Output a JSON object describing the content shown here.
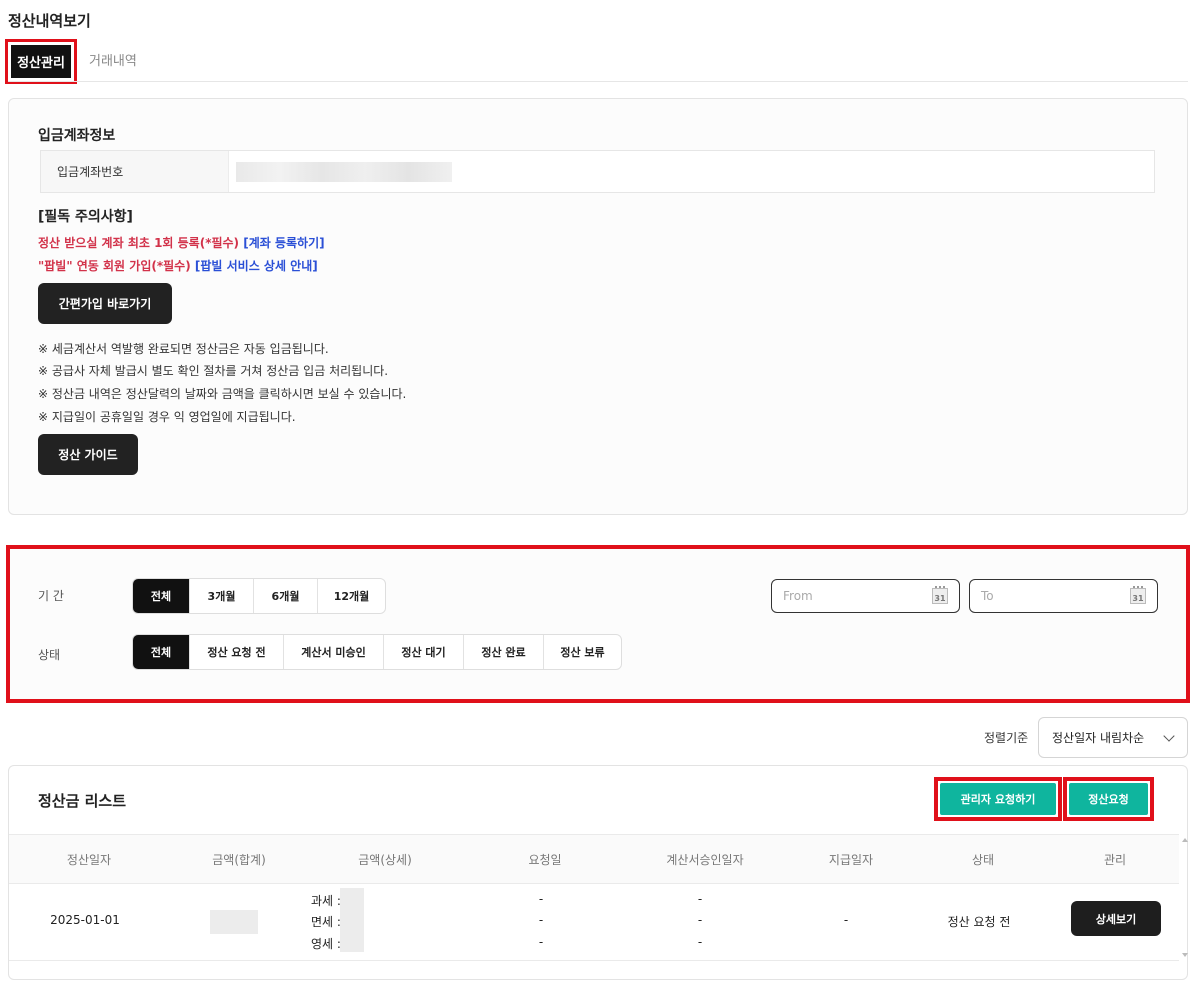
{
  "page_title": "정산내역보기",
  "tabs": [
    {
      "label": "정산관리",
      "active": true
    },
    {
      "label": "거래내역",
      "active": false
    }
  ],
  "account": {
    "section_title": "입금계좌정보",
    "label": "입금계좌번호"
  },
  "notice": {
    "title": "[필독 주의사항]",
    "line1_text": "정산 받으실 계좌 최초 1회 등록(*필수)",
    "line1_link": "[계좌 등록하기]",
    "line2_text": "\"팝빌\" 연동 회원 가입(*필수)",
    "line2_link": "[팝빌 서비스 상세 안내]",
    "signup_button": "간편가입 바로가기",
    "bullets": [
      "※ 세금계산서 역발행 완료되면 정산금은 자동 입금됩니다.",
      "※ 공급사 자체 발급시 별도 확인 절차를 거쳐 정산금 입금 처리됩니다.",
      "※ 정산금 내역은 정산달력의 날짜와 금액을 클릭하시면 보실 수 있습니다.",
      "※ 지급일이 공휴일일 경우 익 영업일에 지급됩니다."
    ],
    "guide_button": "정산 가이드"
  },
  "filters": {
    "period_label": "기 간",
    "period_options": [
      "전체",
      "3개월",
      "6개월",
      "12개월"
    ],
    "status_label": "상태",
    "status_options": [
      "전체",
      "정산 요청 전",
      "계산서 미승인",
      "정산 대기",
      "정산 완료",
      "정산 보류"
    ],
    "from_placeholder": "From",
    "to_placeholder": "To",
    "calendar_day": "31"
  },
  "sort": {
    "label": "정렬기준",
    "selected": "정산일자 내림차순"
  },
  "list": {
    "title": "정산금 리스트",
    "admin_request_button": "관리자 요청하기",
    "settle_request_button": "정산요청",
    "columns": [
      "정산일자",
      "금액(합계)",
      "금액(상세)",
      "요청일",
      "계산서승인일자",
      "지급일자",
      "상태",
      "관리"
    ],
    "rows": [
      {
        "date": "2025-01-01",
        "detail_labels": [
          "과세 :",
          "면세 :",
          "영세 :"
        ],
        "request_dates": [
          "-",
          "-",
          "-"
        ],
        "invoice_dates": [
          "-",
          "-",
          "-"
        ],
        "pay_date": "-",
        "status": "정산 요청 전",
        "action": "상세보기"
      }
    ]
  }
}
